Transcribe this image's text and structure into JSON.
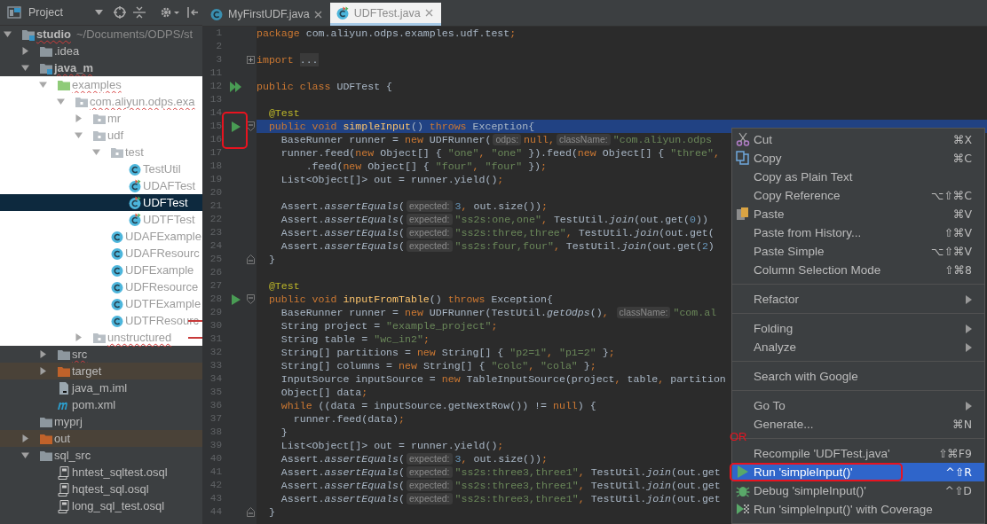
{
  "project_panel": {
    "title": "Project",
    "tree": [
      {
        "label": "studio",
        "detail": "~/Documents/ODPS/st",
        "kind": "module",
        "expanded": true,
        "selected": false,
        "error": true,
        "children": [
          {
            "label": ".idea",
            "kind": "folder",
            "expanded": false,
            "selected": false
          },
          {
            "label": "java_m",
            "kind": "module",
            "expanded": true,
            "selected": false,
            "error": true,
            "children": [
              {
                "label": "examples",
                "kind": "source-folder",
                "light": true,
                "expanded": true,
                "selected": false,
                "error": true,
                "children": [
                  {
                    "label": "com.aliyun.odps.exa",
                    "kind": "package",
                    "light": true,
                    "expanded": true,
                    "selected": false,
                    "error": true,
                    "children": [
                      {
                        "label": "mr",
                        "kind": "package",
                        "light": true,
                        "expanded": false,
                        "selected": false
                      },
                      {
                        "label": "udf",
                        "kind": "package",
                        "light": true,
                        "expanded": true,
                        "selected": false,
                        "children": [
                          {
                            "label": "test",
                            "kind": "package",
                            "light": true,
                            "expanded": true,
                            "selected": false,
                            "children": [
                              {
                                "label": "TestUtil",
                                "kind": "class",
                                "light": true,
                                "selected": false
                              },
                              {
                                "label": "UDAFTest",
                                "kind": "test-class",
                                "light": true,
                                "selected": false
                              },
                              {
                                "label": "UDFTest",
                                "kind": "test-class",
                                "light": true,
                                "selected": true
                              },
                              {
                                "label": "UDTFTest",
                                "kind": "test-class",
                                "light": true,
                                "selected": false
                              }
                            ]
                          },
                          {
                            "label": "UDAFExample",
                            "kind": "class",
                            "light": true,
                            "selected": false
                          },
                          {
                            "label": "UDAFResourc",
                            "kind": "class",
                            "light": true,
                            "selected": false
                          },
                          {
                            "label": "UDFExample",
                            "kind": "class",
                            "light": true,
                            "selected": false
                          },
                          {
                            "label": "UDFResource",
                            "kind": "class",
                            "light": true,
                            "selected": false
                          },
                          {
                            "label": "UDTFExample",
                            "kind": "class",
                            "light": true,
                            "selected": false
                          },
                          {
                            "label": "UDTFResourc",
                            "kind": "class",
                            "light": true,
                            "selected": false,
                            "annotated": true
                          }
                        ]
                      },
                      {
                        "label": "unstructured",
                        "kind": "package",
                        "light": true,
                        "expanded": false,
                        "selected": false,
                        "error": true,
                        "annotated": true
                      }
                    ]
                  }
                ]
              },
              {
                "label": "src",
                "kind": "folder",
                "expanded": false,
                "selected": false,
                "error": true
              },
              {
                "label": "target",
                "kind": "folder",
                "excluded": true,
                "expanded": false,
                "selected": false
              },
              {
                "label": "java_m.iml",
                "kind": "file",
                "selected": false
              },
              {
                "label": "pom.xml",
                "kind": "maven",
                "selected": false
              }
            ]
          },
          {
            "label": "myprj",
            "kind": "folder",
            "selected": false
          },
          {
            "label": "out",
            "kind": "folder",
            "excluded": true,
            "expanded": false,
            "selected": false
          },
          {
            "label": "sql_src",
            "kind": "folder",
            "expanded": true,
            "selected": false,
            "children": [
              {
                "label": "hntest_sqltest.osql",
                "kind": "sql",
                "selected": false
              },
              {
                "label": "hqtest_sql.osql",
                "kind": "sql",
                "selected": false
              },
              {
                "label": "long_sql_test.osql",
                "kind": "sql",
                "selected": false
              }
            ]
          }
        ]
      }
    ]
  },
  "editor": {
    "tabs": [
      {
        "label": "MyFirstUDF.java",
        "kind": "class",
        "selected": false
      },
      {
        "label": "UDFTest.java",
        "kind": "test-class",
        "selected": true
      }
    ],
    "lines": [
      {
        "number": "1",
        "tokens": [
          {
            "kind": "keyword",
            "text": "package "
          },
          {
            "kind": "plain",
            "text": "com.aliyun.odps.examples.udf.test"
          },
          {
            "kind": "keyword",
            "text": ";"
          }
        ]
      },
      {
        "number": "2"
      },
      {
        "number": "3",
        "folded_region": true,
        "tokens": [
          {
            "kind": "keyword",
            "text": "import "
          },
          {
            "kind": "folded",
            "text": "..."
          }
        ]
      },
      {
        "number": "11"
      },
      {
        "number": "12",
        "run_all_marker": true,
        "tokens": [
          {
            "kind": "keyword",
            "text": "public class "
          },
          {
            "kind": "plain",
            "text": "UDFTest {"
          }
        ]
      },
      {
        "number": "13"
      },
      {
        "number": "14",
        "tokens": [
          {
            "kind": "annotation",
            "text": "  @Test"
          }
        ]
      },
      {
        "number": "15",
        "run_marker": true,
        "annotated": true,
        "fold_start": true,
        "current": true,
        "tokens": [
          {
            "kind": "keyword",
            "text": "  public void "
          },
          {
            "kind": "declaration",
            "text": "simpleInput"
          },
          {
            "kind": "plain",
            "text": "() "
          },
          {
            "kind": "keyword",
            "text": "throws "
          },
          {
            "kind": "plain",
            "text": "Exception{"
          }
        ]
      },
      {
        "number": "16",
        "tokens": [
          {
            "kind": "plain",
            "text": "    BaseRunner runner = "
          },
          {
            "kind": "keyword",
            "text": "new "
          },
          {
            "kind": "plain",
            "text": "UDFRunner("
          },
          {
            "kind": "hint",
            "text": "odps:"
          },
          {
            "kind": "keyword",
            "text": "null,"
          },
          {
            "kind": "hint",
            "text": "className:"
          },
          {
            "kind": "string",
            "text": "\"com.aliyun.odps"
          }
        ]
      },
      {
        "number": "17",
        "tokens": [
          {
            "kind": "plain",
            "text": "    runner.feed("
          },
          {
            "kind": "keyword",
            "text": "new "
          },
          {
            "kind": "plain",
            "text": "Object[] { "
          },
          {
            "kind": "string",
            "text": "\"one\""
          },
          {
            "kind": "keyword",
            "text": ", "
          },
          {
            "kind": "string",
            "text": "\"one\""
          },
          {
            "kind": "plain",
            "text": " }).feed("
          },
          {
            "kind": "keyword",
            "text": "new "
          },
          {
            "kind": "plain",
            "text": "Object[] { "
          },
          {
            "kind": "string",
            "text": "\"three\""
          },
          {
            "kind": "keyword",
            "text": ","
          }
        ]
      },
      {
        "number": "18",
        "tokens": [
          {
            "kind": "plain",
            "text": "        .feed("
          },
          {
            "kind": "keyword",
            "text": "new "
          },
          {
            "kind": "plain",
            "text": "Object[] { "
          },
          {
            "kind": "string",
            "text": "\"four\""
          },
          {
            "kind": "keyword",
            "text": ", "
          },
          {
            "kind": "string",
            "text": "\"four\""
          },
          {
            "kind": "plain",
            "text": " })"
          },
          {
            "kind": "keyword",
            "text": ";"
          }
        ]
      },
      {
        "number": "19",
        "tokens": [
          {
            "kind": "plain",
            "text": "    List<Object[]> out = runner.yield()"
          },
          {
            "kind": "keyword",
            "text": ";"
          }
        ]
      },
      {
        "number": "20"
      },
      {
        "number": "21",
        "tokens": [
          {
            "kind": "plain",
            "text": "    Assert."
          },
          {
            "kind": "static-call",
            "text": "assertEquals"
          },
          {
            "kind": "plain",
            "text": "("
          },
          {
            "kind": "hint",
            "text": "expected:"
          },
          {
            "kind": "number",
            "text": "3"
          },
          {
            "kind": "keyword",
            "text": ", "
          },
          {
            "kind": "plain",
            "text": "out.size())"
          },
          {
            "kind": "keyword",
            "text": ";"
          }
        ]
      },
      {
        "number": "22",
        "tokens": [
          {
            "kind": "plain",
            "text": "    Assert."
          },
          {
            "kind": "static-call",
            "text": "assertEquals"
          },
          {
            "kind": "plain",
            "text": "("
          },
          {
            "kind": "hint",
            "text": "expected:"
          },
          {
            "kind": "string",
            "text": "\"ss2s:one,one\""
          },
          {
            "kind": "keyword",
            "text": ", "
          },
          {
            "kind": "plain",
            "text": "TestUtil."
          },
          {
            "kind": "static-call",
            "text": "join"
          },
          {
            "kind": "plain",
            "text": "(out.get("
          },
          {
            "kind": "number",
            "text": "0"
          },
          {
            "kind": "plain",
            "text": "))"
          }
        ]
      },
      {
        "number": "23",
        "tokens": [
          {
            "kind": "plain",
            "text": "    Assert."
          },
          {
            "kind": "static-call",
            "text": "assertEquals"
          },
          {
            "kind": "plain",
            "text": "("
          },
          {
            "kind": "hint",
            "text": "expected:"
          },
          {
            "kind": "string",
            "text": "\"ss2s:three,three\""
          },
          {
            "kind": "keyword",
            "text": ", "
          },
          {
            "kind": "plain",
            "text": "TestUtil."
          },
          {
            "kind": "static-call",
            "text": "join"
          },
          {
            "kind": "plain",
            "text": "(out.get("
          }
        ]
      },
      {
        "number": "24",
        "tokens": [
          {
            "kind": "plain",
            "text": "    Assert."
          },
          {
            "kind": "static-call",
            "text": "assertEquals"
          },
          {
            "kind": "plain",
            "text": "("
          },
          {
            "kind": "hint",
            "text": "expected:"
          },
          {
            "kind": "string",
            "text": "\"ss2s:four,four\""
          },
          {
            "kind": "keyword",
            "text": ", "
          },
          {
            "kind": "plain",
            "text": "TestUtil."
          },
          {
            "kind": "static-call",
            "text": "join"
          },
          {
            "kind": "plain",
            "text": "(out.get("
          },
          {
            "kind": "number",
            "text": "2"
          },
          {
            "kind": "plain",
            "text": ")"
          }
        ]
      },
      {
        "number": "25",
        "fold_end": true,
        "tokens": [
          {
            "kind": "plain",
            "text": "  }"
          }
        ]
      },
      {
        "number": "26"
      },
      {
        "number": "27",
        "tokens": [
          {
            "kind": "annotation",
            "text": "  @Test"
          }
        ]
      },
      {
        "number": "28",
        "run_marker": true,
        "fold_start": true,
        "tokens": [
          {
            "kind": "keyword",
            "text": "  public void "
          },
          {
            "kind": "declaration",
            "text": "inputFromTable"
          },
          {
            "kind": "plain",
            "text": "() "
          },
          {
            "kind": "keyword",
            "text": "throws "
          },
          {
            "kind": "plain",
            "text": "Exception{"
          }
        ]
      },
      {
        "number": "29",
        "tokens": [
          {
            "kind": "plain",
            "text": "    BaseRunner runner = "
          },
          {
            "kind": "keyword",
            "text": "new "
          },
          {
            "kind": "plain",
            "text": "UDFRunner(TestUtil."
          },
          {
            "kind": "static-call",
            "text": "getOdps"
          },
          {
            "kind": "plain",
            "text": "()"
          },
          {
            "kind": "keyword",
            "text": ", "
          },
          {
            "kind": "hint",
            "text": "className:"
          },
          {
            "kind": "string",
            "text": "\"com.al"
          }
        ]
      },
      {
        "number": "30",
        "tokens": [
          {
            "kind": "plain",
            "text": "    String project = "
          },
          {
            "kind": "string",
            "text": "\"example_project\""
          },
          {
            "kind": "keyword",
            "text": ";"
          }
        ]
      },
      {
        "number": "31",
        "tokens": [
          {
            "kind": "plain",
            "text": "    String table = "
          },
          {
            "kind": "string",
            "text": "\"wc_in2\""
          },
          {
            "kind": "keyword",
            "text": ";"
          }
        ]
      },
      {
        "number": "32",
        "tokens": [
          {
            "kind": "plain",
            "text": "    String[] partitions = "
          },
          {
            "kind": "keyword",
            "text": "new "
          },
          {
            "kind": "plain",
            "text": "String[] { "
          },
          {
            "kind": "string",
            "text": "\"p2=1\""
          },
          {
            "kind": "keyword",
            "text": ", "
          },
          {
            "kind": "string",
            "text": "\"p1=2\""
          },
          {
            "kind": "plain",
            "text": " }"
          },
          {
            "kind": "keyword",
            "text": ";"
          }
        ]
      },
      {
        "number": "33",
        "tokens": [
          {
            "kind": "plain",
            "text": "    String[] columns = "
          },
          {
            "kind": "keyword",
            "text": "new "
          },
          {
            "kind": "plain",
            "text": "String[] { "
          },
          {
            "kind": "string",
            "text": "\"colc\""
          },
          {
            "kind": "keyword",
            "text": ", "
          },
          {
            "kind": "string",
            "text": "\"cola\""
          },
          {
            "kind": "plain",
            "text": " }"
          },
          {
            "kind": "keyword",
            "text": ";"
          }
        ]
      },
      {
        "number": "34",
        "tokens": [
          {
            "kind": "plain",
            "text": "    InputSource inputSource = "
          },
          {
            "kind": "keyword",
            "text": "new "
          },
          {
            "kind": "plain",
            "text": "TableInputSource(project"
          },
          {
            "kind": "keyword",
            "text": ", "
          },
          {
            "kind": "plain",
            "text": "table"
          },
          {
            "kind": "keyword",
            "text": ", "
          },
          {
            "kind": "plain",
            "text": "partition"
          }
        ]
      },
      {
        "number": "35",
        "tokens": [
          {
            "kind": "plain",
            "text": "    Object[] data"
          },
          {
            "kind": "keyword",
            "text": ";"
          }
        ]
      },
      {
        "number": "36",
        "tokens": [
          {
            "kind": "keyword",
            "text": "    while "
          },
          {
            "kind": "plain",
            "text": "((data = inputSource.getNextRow()) != "
          },
          {
            "kind": "keyword",
            "text": "null"
          },
          {
            "kind": "plain",
            "text": ") {"
          }
        ]
      },
      {
        "number": "37",
        "tokens": [
          {
            "kind": "plain",
            "text": "      runner.feed(data)"
          },
          {
            "kind": "keyword",
            "text": ";"
          }
        ]
      },
      {
        "number": "38",
        "tokens": [
          {
            "kind": "plain",
            "text": "    }"
          }
        ]
      },
      {
        "number": "39",
        "tokens": [
          {
            "kind": "plain",
            "text": "    List<Object[]> out = runner.yield()"
          },
          {
            "kind": "keyword",
            "text": ";"
          }
        ]
      },
      {
        "number": "40",
        "tokens": [
          {
            "kind": "plain",
            "text": "    Assert."
          },
          {
            "kind": "static-call",
            "text": "assertEquals"
          },
          {
            "kind": "plain",
            "text": "("
          },
          {
            "kind": "hint",
            "text": "expected:"
          },
          {
            "kind": "number",
            "text": "3"
          },
          {
            "kind": "keyword",
            "text": ", "
          },
          {
            "kind": "plain",
            "text": "out.size())"
          },
          {
            "kind": "keyword",
            "text": ";"
          }
        ]
      },
      {
        "number": "41",
        "tokens": [
          {
            "kind": "plain",
            "text": "    Assert."
          },
          {
            "kind": "static-call",
            "text": "assertEquals"
          },
          {
            "kind": "plain",
            "text": "("
          },
          {
            "kind": "hint",
            "text": "expected:"
          },
          {
            "kind": "string",
            "text": "\"ss2s:three3,three1\""
          },
          {
            "kind": "keyword",
            "text": ", "
          },
          {
            "kind": "plain",
            "text": "TestUtil."
          },
          {
            "kind": "static-call",
            "text": "join"
          },
          {
            "kind": "plain",
            "text": "(out.get"
          }
        ]
      },
      {
        "number": "42",
        "tokens": [
          {
            "kind": "plain",
            "text": "    Assert."
          },
          {
            "kind": "static-call",
            "text": "assertEquals"
          },
          {
            "kind": "plain",
            "text": "("
          },
          {
            "kind": "hint",
            "text": "expected:"
          },
          {
            "kind": "string",
            "text": "\"ss2s:three3,three1\""
          },
          {
            "kind": "keyword",
            "text": ", "
          },
          {
            "kind": "plain",
            "text": "TestUtil."
          },
          {
            "kind": "static-call",
            "text": "join"
          },
          {
            "kind": "plain",
            "text": "(out.get"
          }
        ]
      },
      {
        "number": "43",
        "tokens": [
          {
            "kind": "plain",
            "text": "    Assert."
          },
          {
            "kind": "static-call",
            "text": "assertEquals"
          },
          {
            "kind": "plain",
            "text": "("
          },
          {
            "kind": "hint",
            "text": "expected:"
          },
          {
            "kind": "string",
            "text": "\"ss2s:three3,three1\""
          },
          {
            "kind": "keyword",
            "text": ", "
          },
          {
            "kind": "plain",
            "text": "TestUtil."
          },
          {
            "kind": "static-call",
            "text": "join"
          },
          {
            "kind": "plain",
            "text": "(out.get"
          }
        ]
      },
      {
        "number": "44",
        "fold_end": true,
        "tokens": [
          {
            "kind": "plain",
            "text": "  }"
          }
        ]
      }
    ]
  },
  "context_menu": {
    "items": [
      {
        "kind": "item",
        "label": "Cut",
        "shortcut": "⌘X",
        "selected": false
      },
      {
        "kind": "item",
        "label": "Copy",
        "shortcut": "⌘C",
        "selected": false
      },
      {
        "kind": "item",
        "label": "Copy as Plain Text",
        "selected": false
      },
      {
        "kind": "item",
        "label": "Copy Reference",
        "shortcut": "⌥⇧⌘C",
        "selected": false
      },
      {
        "kind": "item",
        "label": "Paste",
        "shortcut": "⌘V",
        "selected": false
      },
      {
        "kind": "item",
        "label": "Paste from History...",
        "shortcut": "⇧⌘V",
        "selected": false
      },
      {
        "kind": "item",
        "label": "Paste Simple",
        "shortcut": "⌥⇧⌘V",
        "selected": false
      },
      {
        "kind": "item",
        "label": "Column Selection Mode",
        "shortcut": "⇧⌘8",
        "selected": false
      },
      {
        "kind": "separator"
      },
      {
        "kind": "item",
        "label": "Refactor",
        "submenu": true,
        "selected": false
      },
      {
        "kind": "separator"
      },
      {
        "kind": "item",
        "label": "Folding",
        "submenu": true,
        "selected": false
      },
      {
        "kind": "item",
        "label": "Analyze",
        "submenu": true,
        "selected": false
      },
      {
        "kind": "separator"
      },
      {
        "kind": "item",
        "label": "Search with Google",
        "selected": false
      },
      {
        "kind": "separator"
      },
      {
        "kind": "item",
        "label": "Go To",
        "submenu": true,
        "selected": false
      },
      {
        "kind": "item",
        "label": "Generate...",
        "shortcut": "⌘N",
        "selected": false
      },
      {
        "kind": "separator"
      },
      {
        "kind": "item",
        "label": "Recompile 'UDFTest.java'",
        "shortcut": "⇧⌘F9",
        "selected": false
      },
      {
        "kind": "item",
        "label": "Run 'simpleInput()'",
        "shortcut": "^⇧R",
        "selected": true,
        "annotated": true,
        "note": "OR"
      },
      {
        "kind": "item",
        "label": "Debug 'simpleInput()'",
        "shortcut": "^⇧D",
        "selected": false
      },
      {
        "kind": "item",
        "label": "Run 'simpleInput()' with Coverage",
        "selected": false
      }
    ]
  }
}
